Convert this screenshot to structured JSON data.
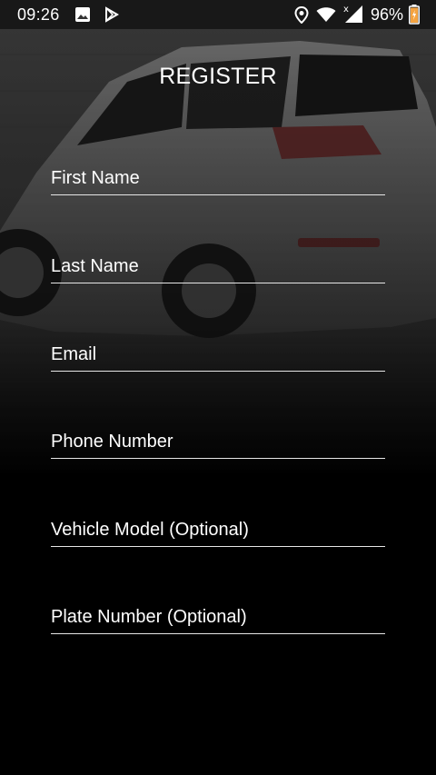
{
  "status_bar": {
    "time": "09:26",
    "battery": "96%",
    "icons": [
      "image-icon",
      "play-store-icon",
      "location-icon",
      "wifi-icon",
      "signal-icon",
      "battery-icon"
    ]
  },
  "header": {
    "title": "REGISTER"
  },
  "form": {
    "first_name": {
      "placeholder": "First Name",
      "value": ""
    },
    "last_name": {
      "placeholder": "Last Name",
      "value": ""
    },
    "email": {
      "placeholder": "Email",
      "value": ""
    },
    "phone": {
      "placeholder": "Phone Number",
      "value": ""
    },
    "vehicle_model": {
      "placeholder": "Vehicle Model (Optional)",
      "value": ""
    },
    "plate_number": {
      "placeholder": "Plate Number (Optional)",
      "value": ""
    }
  },
  "colors": {
    "background": "#000000",
    "text": "#ffffff",
    "underline": "#e6e6e6",
    "battery_accent": "#f4a340"
  }
}
